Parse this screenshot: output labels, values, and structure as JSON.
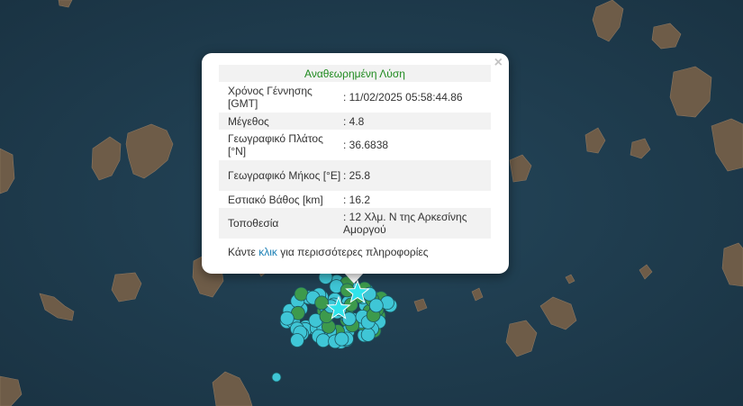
{
  "popup": {
    "title": "Αναθεωρημένη Λύση",
    "close_symbol": "×",
    "rows": [
      {
        "label": "Χρόνος Γέννησης [GMT]",
        "value": ": 11/02/2025 05:58:44.86"
      },
      {
        "label": "Μέγεθος",
        "value": ": 4.8"
      },
      {
        "label": "Γεωγραφικό Πλάτος [°N]",
        "value": ": 36.6838"
      },
      {
        "label": "Γεωγραφικό Μήκος [°E]",
        "value": ": 25.8"
      },
      {
        "label": "Εστιακό Βάθος [km]",
        "value": ": 16.2"
      },
      {
        "label": "Τοποθεσία",
        "value": ": 12 Χλμ. Ν της Αρκεσίνης Αμοργού"
      }
    ],
    "more_prefix": "Κάντε ",
    "more_link": "κλικ",
    "more_suffix": " για περισσότερες πληροφορίες"
  },
  "colors": {
    "sea": "#1f3a4b",
    "land": "#6f5a45",
    "cyan_marker": "#3fc6d6",
    "green_marker": "#3d9a4c",
    "star": "#2fe3ea"
  }
}
